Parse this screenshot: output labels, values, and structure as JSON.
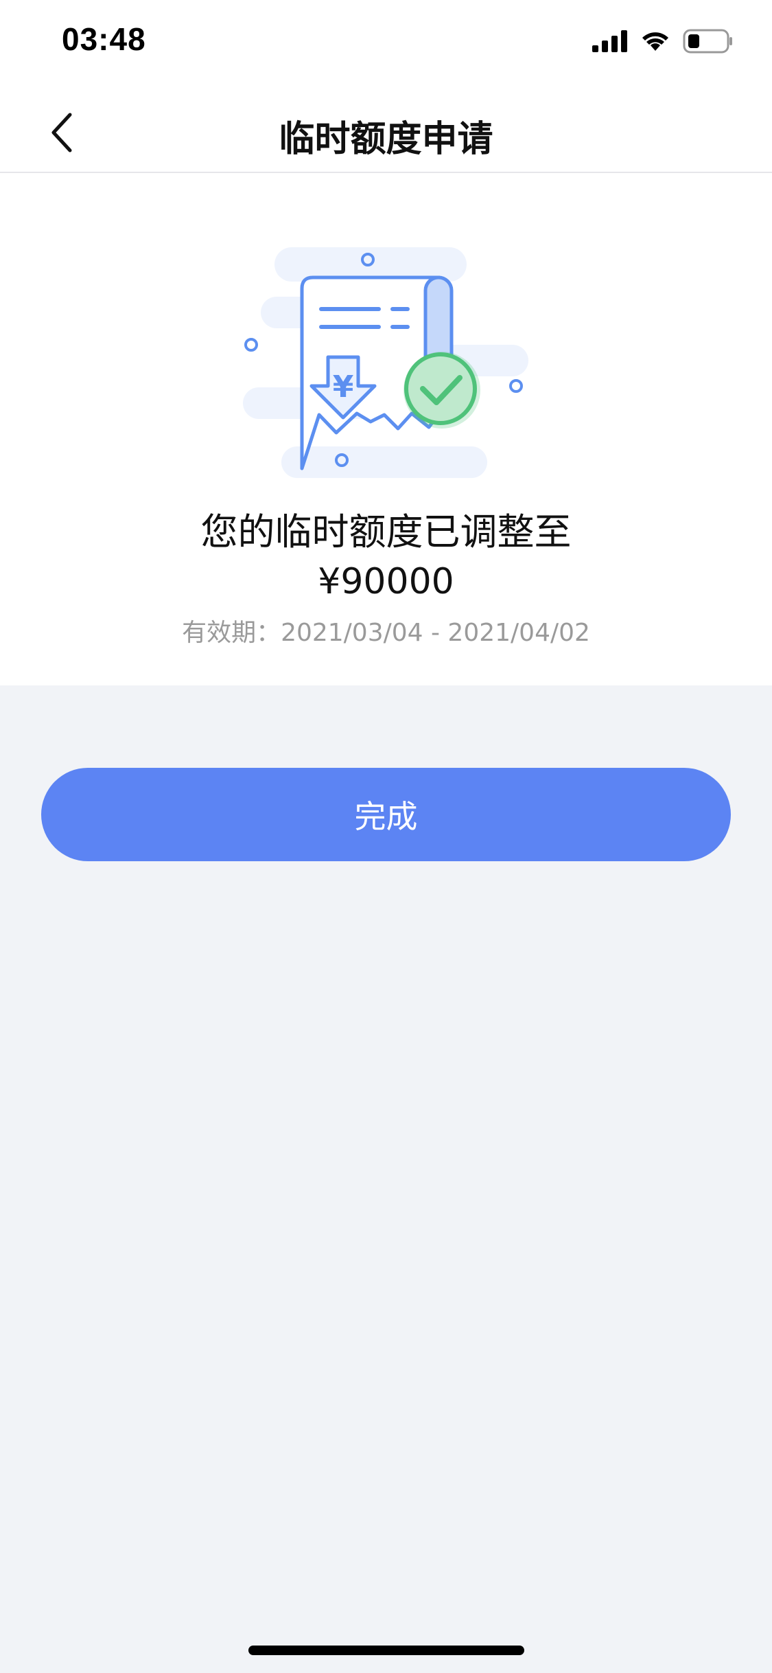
{
  "status_bar": {
    "time": "03:48"
  },
  "nav": {
    "title": "临时额度申请"
  },
  "result": {
    "message": "您的临时额度已调整至",
    "amount": "¥90000",
    "validity": "有效期：2021/03/04 - 2021/04/02",
    "illustration_icon": "receipt-check-icon",
    "currency_symbol": "¥"
  },
  "actions": {
    "done_label": "完成"
  },
  "colors": {
    "primary": "#5c84f3",
    "success": "#4fc27a",
    "background": "#f1f3f7"
  }
}
